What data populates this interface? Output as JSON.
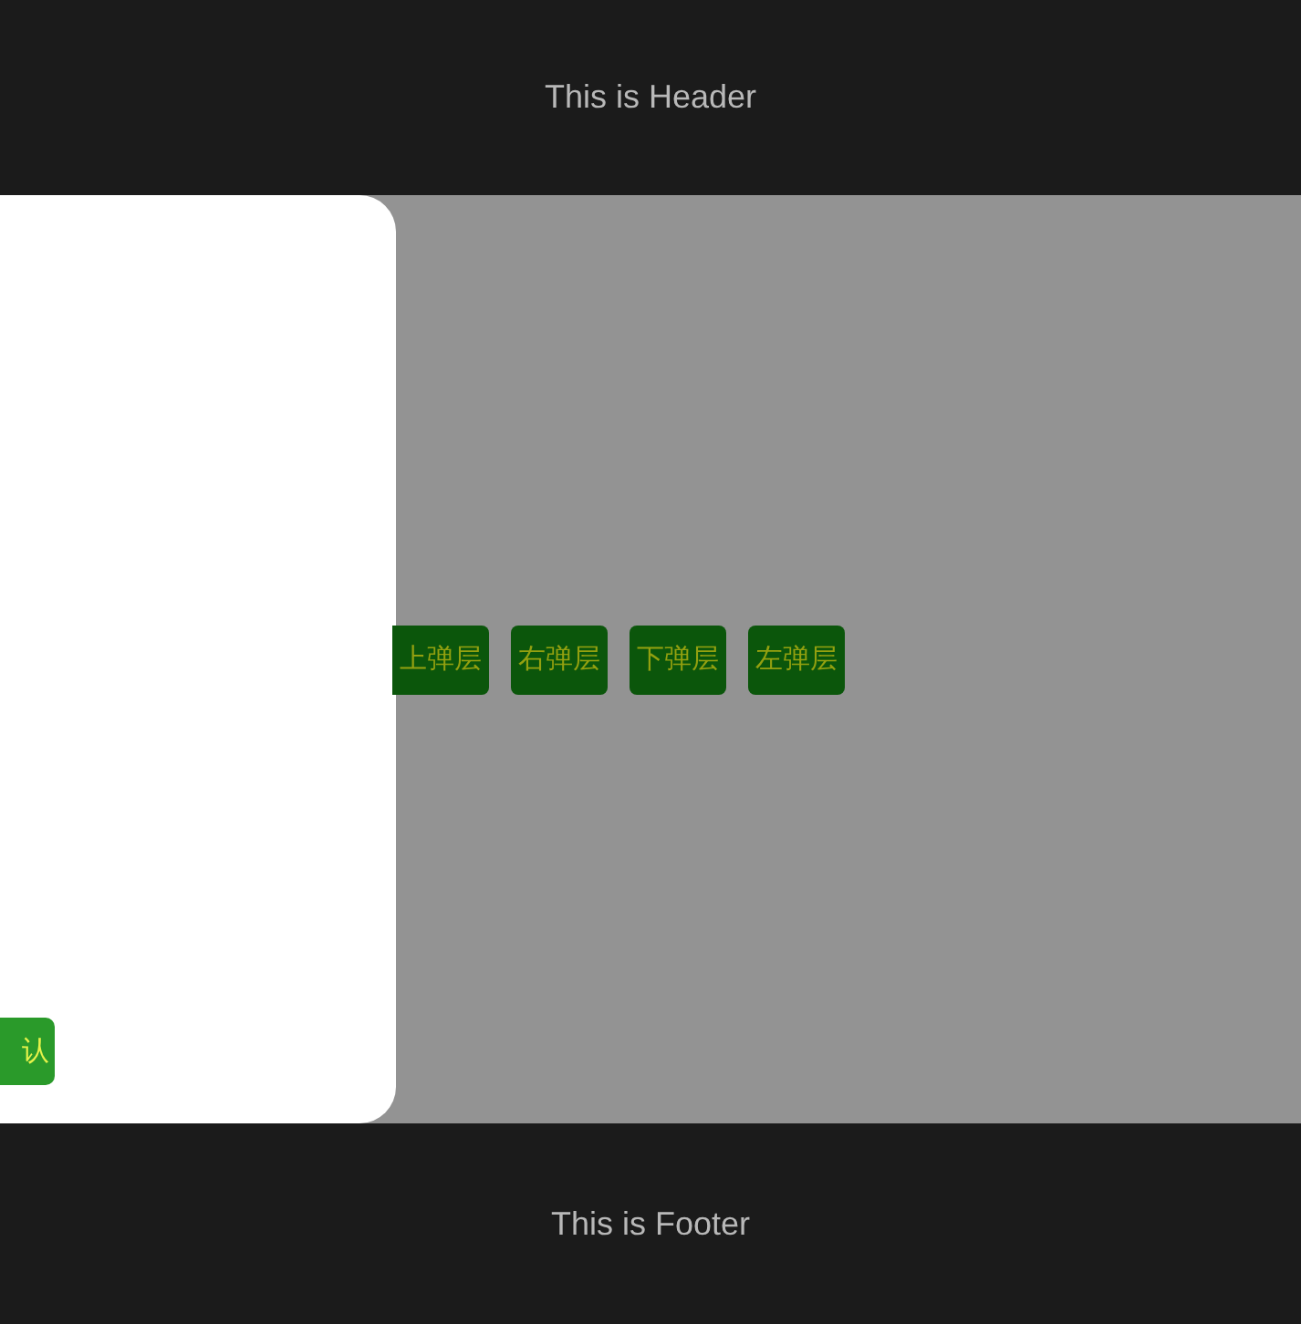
{
  "header": {
    "title": "This is Header"
  },
  "popup": {
    "confirm_button": "认"
  },
  "buttons": [
    {
      "label": "上弹层"
    },
    {
      "label": "右弹层"
    },
    {
      "label": "下弹层"
    },
    {
      "label": "左弹层"
    }
  ],
  "footer": {
    "text": "This is Footer"
  }
}
